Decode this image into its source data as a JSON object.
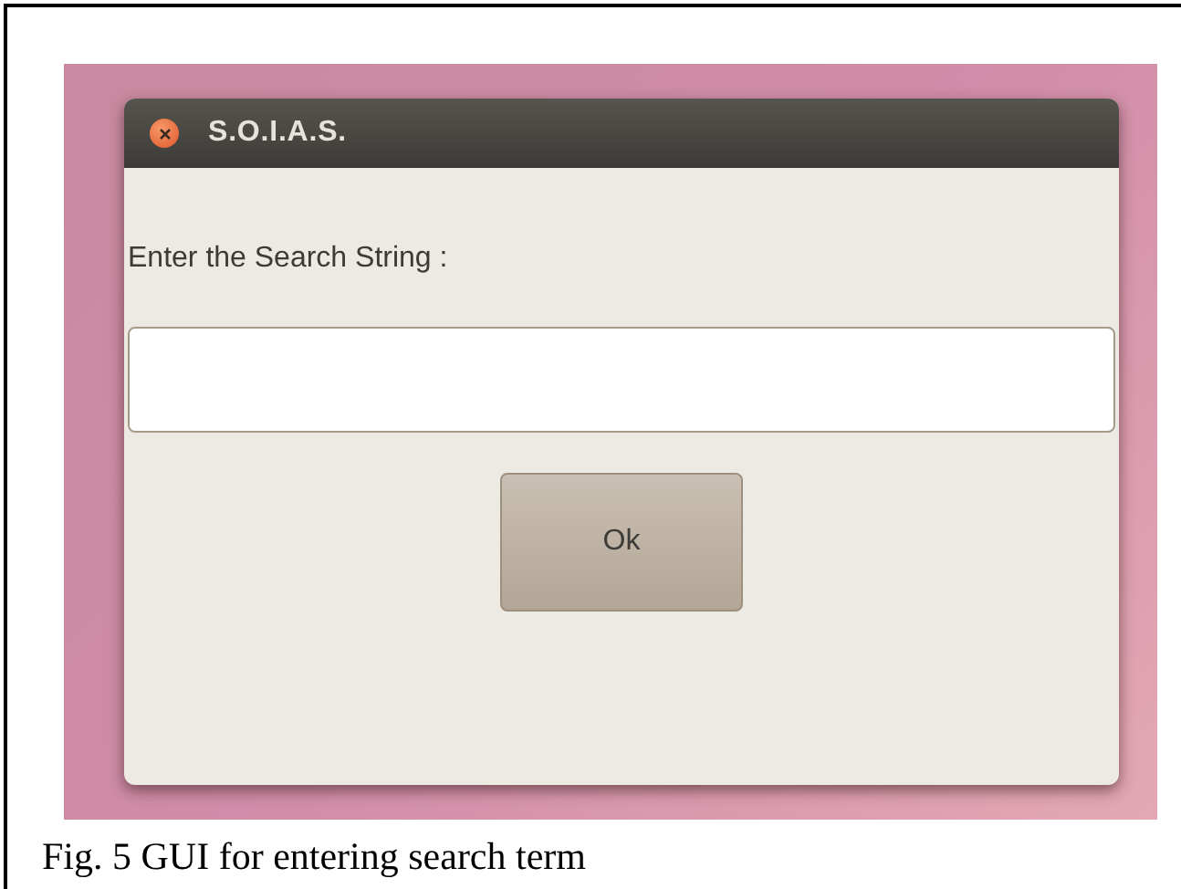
{
  "window": {
    "title": "S.O.I.A.S."
  },
  "prompt": "Enter the Search String :",
  "buttons": [
    "Ok"
  ],
  "caption": "Fig. 5 GUI for entering search term"
}
